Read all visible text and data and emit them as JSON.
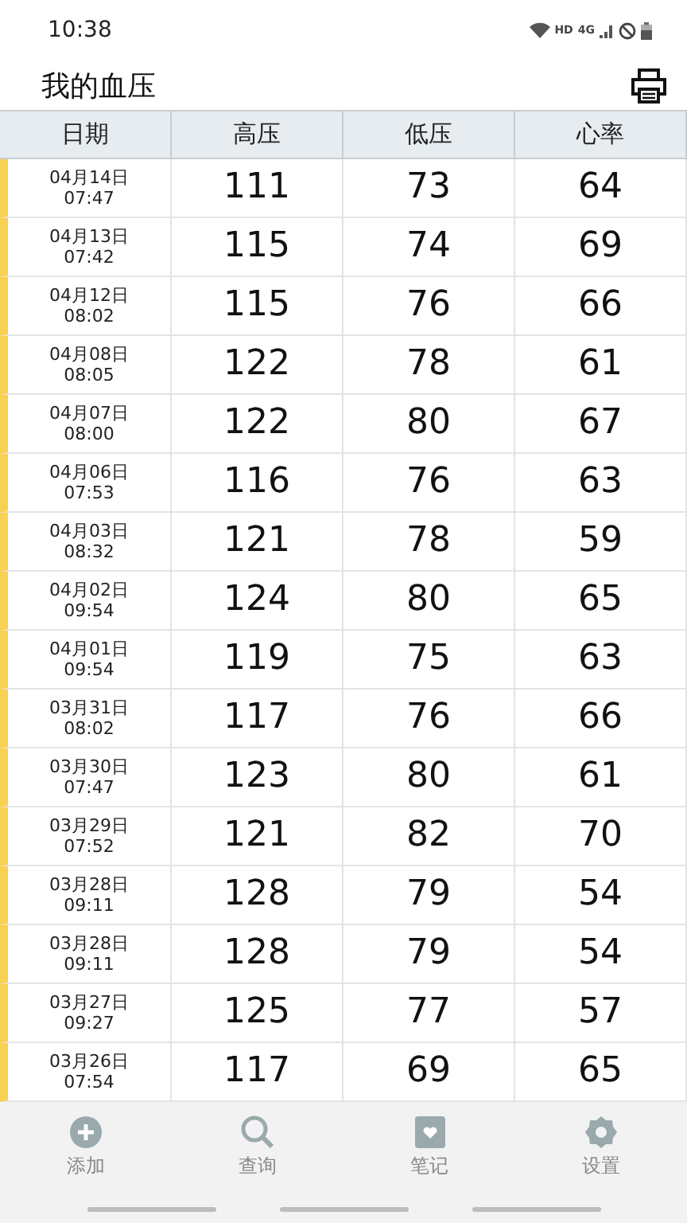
{
  "status_bar": {
    "time": "10:38",
    "hd": "HD",
    "network": "4G"
  },
  "header": {
    "title": "我的血压"
  },
  "table": {
    "columns": [
      "日期",
      "高压",
      "低压",
      "心率"
    ],
    "rows": [
      {
        "date": "04月14日",
        "time": "07:47",
        "systolic": "111",
        "diastolic": "73",
        "pulse": "64"
      },
      {
        "date": "04月13日",
        "time": "07:42",
        "systolic": "115",
        "diastolic": "74",
        "pulse": "69"
      },
      {
        "date": "04月12日",
        "time": "08:02",
        "systolic": "115",
        "diastolic": "76",
        "pulse": "66"
      },
      {
        "date": "04月08日",
        "time": "08:05",
        "systolic": "122",
        "diastolic": "78",
        "pulse": "61"
      },
      {
        "date": "04月07日",
        "time": "08:00",
        "systolic": "122",
        "diastolic": "80",
        "pulse": "67"
      },
      {
        "date": "04月06日",
        "time": "07:53",
        "systolic": "116",
        "diastolic": "76",
        "pulse": "63"
      },
      {
        "date": "04月03日",
        "time": "08:32",
        "systolic": "121",
        "diastolic": "78",
        "pulse": "59"
      },
      {
        "date": "04月02日",
        "time": "09:54",
        "systolic": "124",
        "diastolic": "80",
        "pulse": "65"
      },
      {
        "date": "04月01日",
        "time": "09:54",
        "systolic": "119",
        "diastolic": "75",
        "pulse": "63"
      },
      {
        "date": "03月31日",
        "time": "08:02",
        "systolic": "117",
        "diastolic": "76",
        "pulse": "66"
      },
      {
        "date": "03月30日",
        "time": "07:47",
        "systolic": "123",
        "diastolic": "80",
        "pulse": "61"
      },
      {
        "date": "03月29日",
        "time": "07:52",
        "systolic": "121",
        "diastolic": "82",
        "pulse": "70"
      },
      {
        "date": "03月28日",
        "time": "09:11",
        "systolic": "128",
        "diastolic": "79",
        "pulse": "54"
      },
      {
        "date": "03月28日",
        "time": "09:11",
        "systolic": "128",
        "diastolic": "79",
        "pulse": "54"
      },
      {
        "date": "03月27日",
        "time": "09:27",
        "systolic": "125",
        "diastolic": "77",
        "pulse": "57"
      },
      {
        "date": "03月26日",
        "time": "07:54",
        "systolic": "117",
        "diastolic": "69",
        "pulse": "65"
      }
    ]
  },
  "bottom_nav": [
    {
      "kind": "add",
      "label": "添加"
    },
    {
      "kind": "search",
      "label": "查询"
    },
    {
      "kind": "notes",
      "label": "笔记"
    },
    {
      "kind": "settings",
      "label": "设置"
    }
  ]
}
